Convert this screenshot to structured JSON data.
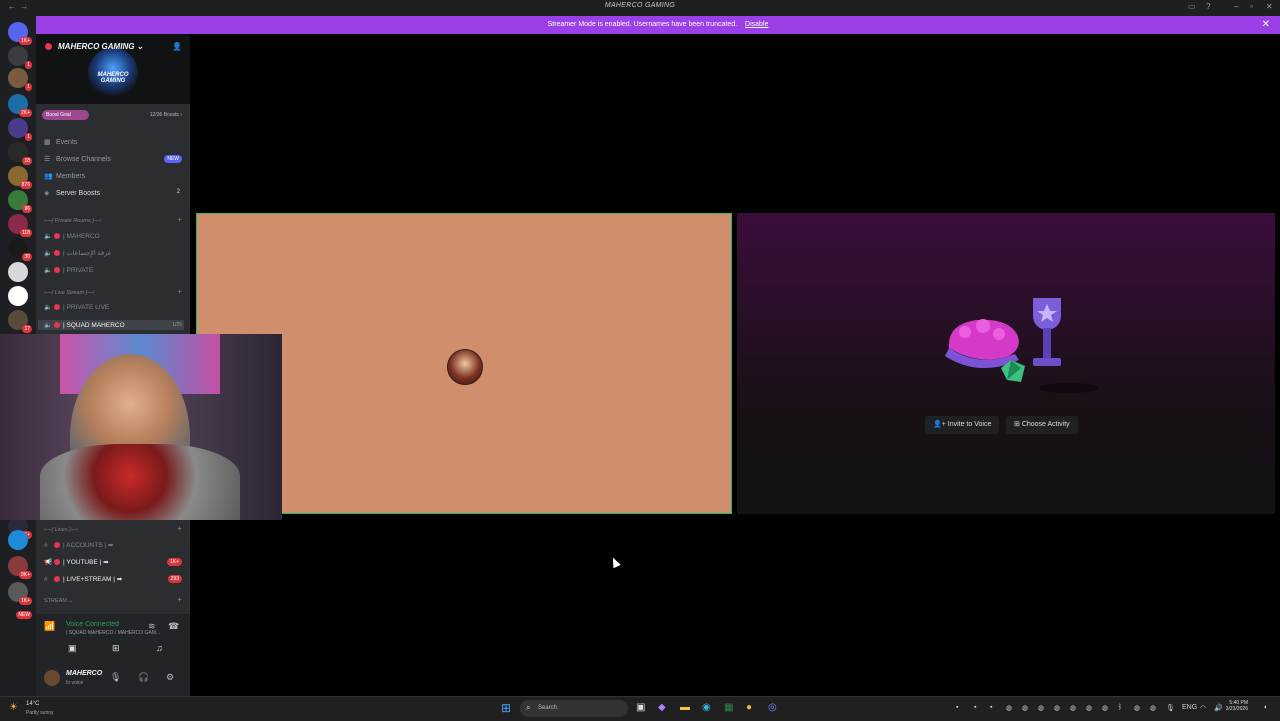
{
  "window": {
    "title": "MAHERCO GAMING"
  },
  "banner": {
    "message": "Streamer Mode is enabled. Usernames have been truncated.",
    "disable_label": "Disable"
  },
  "server": {
    "name": "MAHERCO GAMING ⌄",
    "logo_text": "MAHERCO GAMING",
    "boost_label": "Boost Goal",
    "boost_count": "12/36 Boosts ›",
    "boost_progress": 0.33
  },
  "nav": [
    {
      "label": "Events",
      "icon": "calendar-icon"
    },
    {
      "label": "Browse Channels",
      "icon": "browse-icon",
      "pill": "NEW"
    },
    {
      "label": "Members",
      "icon": "members-icon"
    },
    {
      "label": "Server Boosts",
      "icon": "boost-icon",
      "count": "2"
    }
  ],
  "categories": {
    "private": "›—( Private Rooms )—‹",
    "live_stream": "›—( Live Stream )—‹",
    "lives": "›—( Lives )—‹",
    "stream": "STREAM ⌄"
  },
  "channels": {
    "private": [
      "| MAHERCO",
      "| غرفة الإجتماعات",
      "| PRIVATE"
    ],
    "live": [
      "| PRIVATE LIVE",
      "| SQUAD MAHERCO"
    ],
    "live_count": "1/25",
    "lives": [
      {
        "label": "| ACCOUNTS |",
        "badge": ""
      },
      {
        "label": "| YOUTUBE |",
        "badge": "1K+"
      },
      {
        "label": "| LIVE+STREAM |",
        "badge": "293"
      }
    ]
  },
  "voice": {
    "status": "Voice Connected",
    "channel": "| SQUAD MAHERCO / MAHERCO GAM..."
  },
  "user": {
    "name": "MAHERCO",
    "status": "In voice"
  },
  "stage": {
    "invite_label": "Invite to Voice",
    "activity_label": "Choose Activity"
  },
  "taskbar": {
    "weather_temp": "14°C",
    "weather_desc": "Partly sunny",
    "search_placeholder": "Search",
    "lang": "ENG",
    "time": "5:40 PM",
    "date": "3/23/2026"
  },
  "rail_badges": [
    "1K+",
    "1",
    "2K+",
    "1",
    "18",
    "876",
    "96",
    "118",
    "30",
    "17",
    "1K+",
    "9K+",
    "1K+",
    "NEW"
  ],
  "colors": {
    "accent": "#9b3fe6",
    "speaking": "#2fb857",
    "tile": "#d18e6c",
    "danger": "#da373c"
  }
}
